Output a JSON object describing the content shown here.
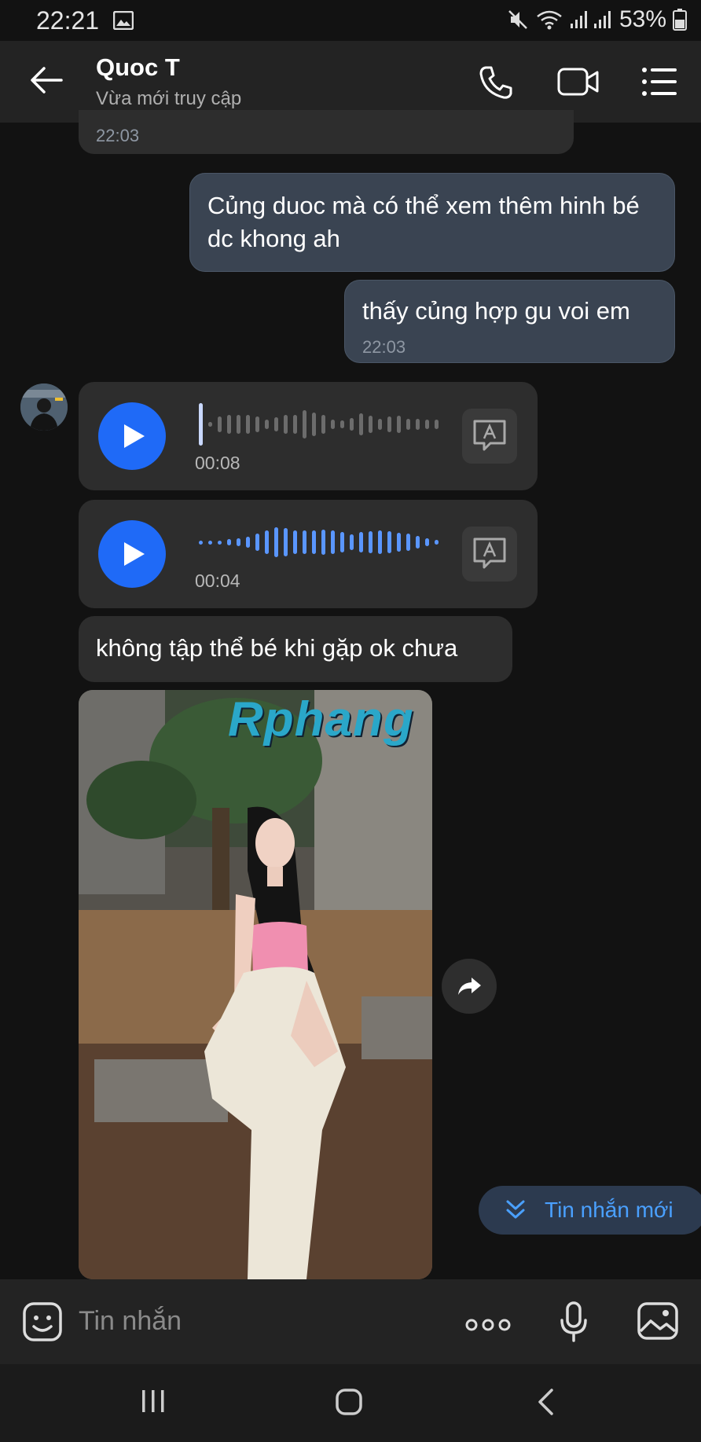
{
  "status_bar": {
    "time": "22:21",
    "battery": "53%",
    "icons": [
      "gallery-icon",
      "mute-icon",
      "wifi-icon",
      "signal-icon",
      "battery-icon"
    ]
  },
  "header": {
    "name": "Quoc T",
    "status": "Vừa mới truy cập"
  },
  "messages": {
    "prev_time": "22:03",
    "out1_text": "Củng duoc mà có thể xem thêm hinh bé dc khong ah",
    "out2_text": "thấy củng hợp gu voi em",
    "out2_time": "22:03",
    "voice1_duration": "00:08",
    "voice2_duration": "00:04",
    "in_text": "không tập thể bé khi gặp ok chưa",
    "photo_watermark": "Rphang"
  },
  "new_messages_label": "Tin nhắn mới",
  "composer": {
    "placeholder": "Tin nhắn"
  },
  "colors": {
    "accent": "#1f6af7",
    "link": "#4aa0ff",
    "bg": "#121212"
  }
}
